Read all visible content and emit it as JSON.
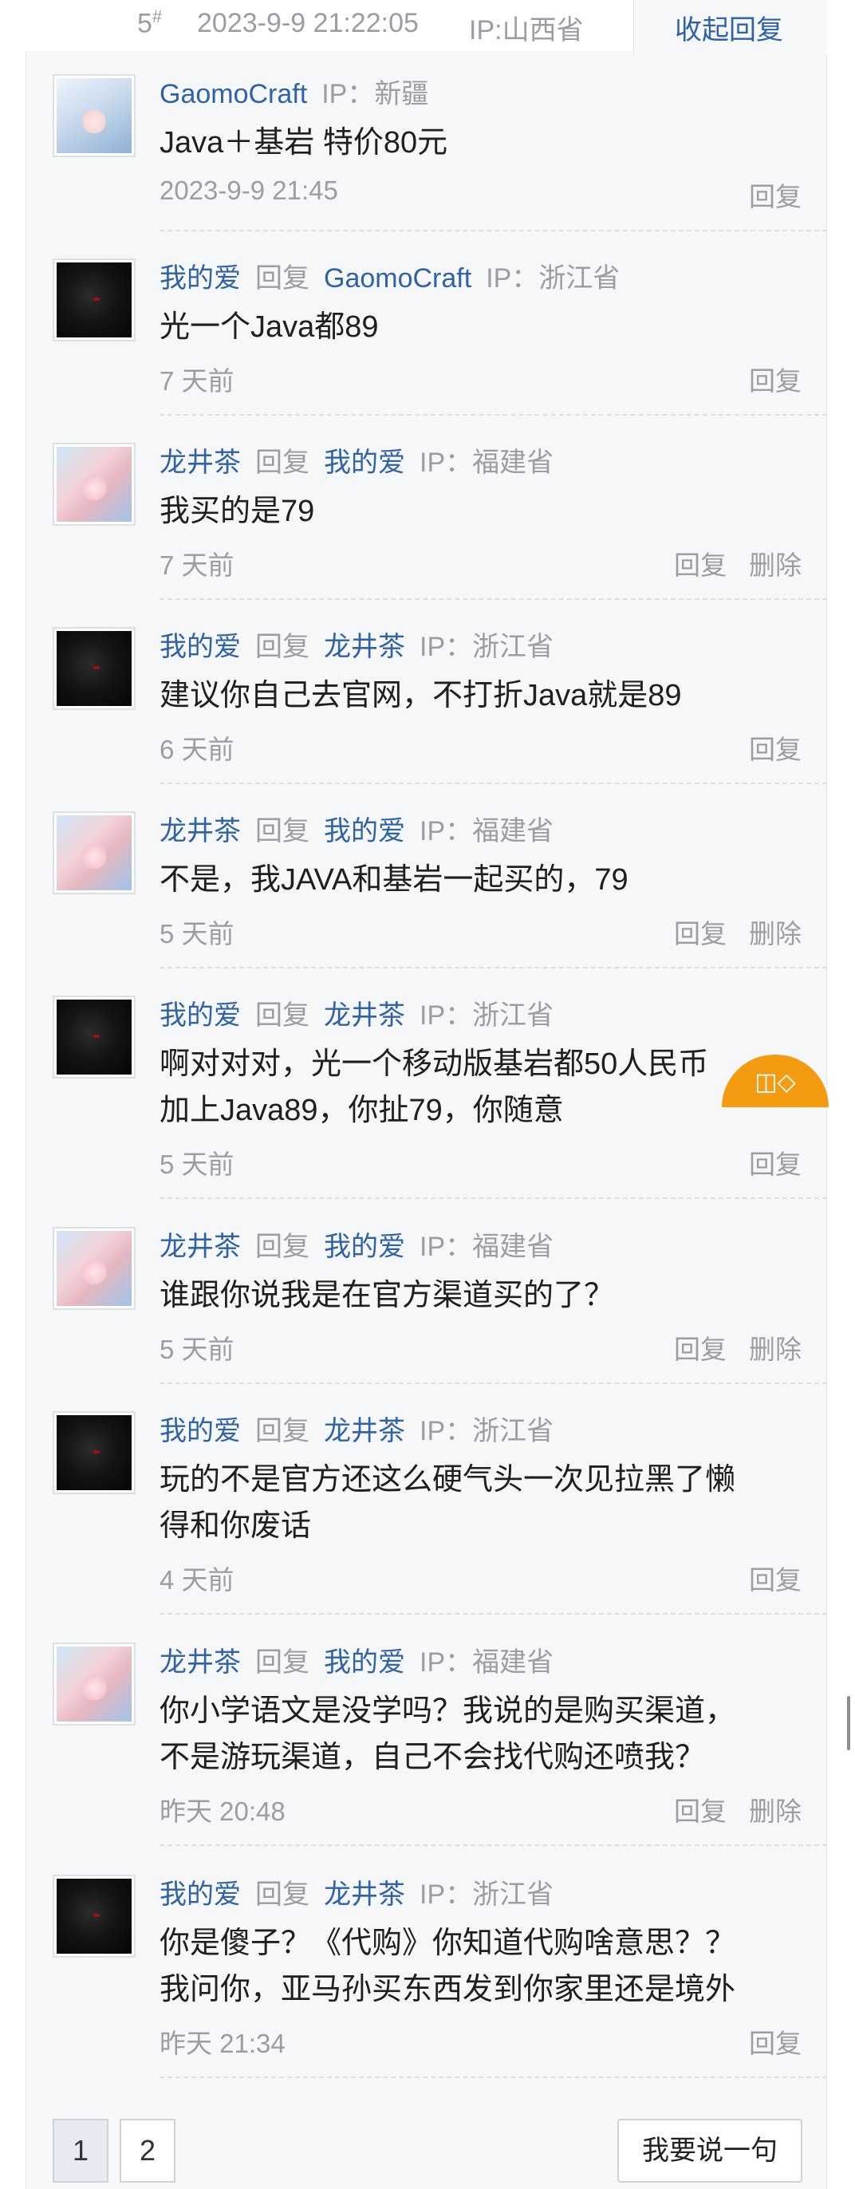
{
  "floor": {
    "number": "5",
    "number_mark": "#",
    "time": "2023-9-9 21:22:05",
    "ip": "IP:山西省",
    "collapse_label": "收起回复"
  },
  "labels": {
    "reply_word": "回复",
    "ip_prefix": "IP：",
    "reply_action": "回复",
    "delete_action": "删除"
  },
  "replies": [
    {
      "avatar": "gao-avatar",
      "user": "GaomoCraft",
      "reply_to": "",
      "ip": "新疆",
      "lines": [
        "Java＋基岩 特价80元"
      ],
      "time": "2023-9-9 21:45",
      "deletable": false
    },
    {
      "avatar": "dark-avatar",
      "user": "我的爱",
      "reply_to": "GaomoCraft",
      "ip": "浙江省",
      "lines": [
        "光一个Java都89"
      ],
      "time": "7 天前",
      "deletable": false
    },
    {
      "avatar": "girl-avatar",
      "user": "龙井茶",
      "reply_to": "我的爱",
      "ip": "福建省",
      "lines": [
        "我买的是79"
      ],
      "time": "7 天前",
      "deletable": true
    },
    {
      "avatar": "dark-avatar",
      "user": "我的爱",
      "reply_to": "龙井茶",
      "ip": "浙江省",
      "lines": [
        "建议你自己去官网，不打折Java就是89"
      ],
      "time": "6 天前",
      "deletable": false
    },
    {
      "avatar": "girl-avatar",
      "user": "龙井茶",
      "reply_to": "我的爱",
      "ip": "福建省",
      "lines": [
        "不是，我JAVA和基岩一起买的，79"
      ],
      "time": "5 天前",
      "deletable": true
    },
    {
      "avatar": "dark-avatar",
      "user": "我的爱",
      "reply_to": "龙井茶",
      "ip": "浙江省",
      "lines": [
        "啊对对对，光一个移动版基岩都50人民币",
        "加上Java89，你扯79，你随意"
      ],
      "time": "5 天前",
      "deletable": false
    },
    {
      "avatar": "girl-avatar",
      "user": "龙井茶",
      "reply_to": "我的爱",
      "ip": "福建省",
      "lines": [
        "谁跟你说我是在官方渠道买的了？"
      ],
      "time": "5 天前",
      "deletable": true
    },
    {
      "avatar": "dark-avatar",
      "user": "我的爱",
      "reply_to": "龙井茶",
      "ip": "浙江省",
      "lines": [
        "玩的不是官方还这么硬气头一次见拉黑了懒",
        "得和你废话"
      ],
      "time": "4 天前",
      "deletable": false
    },
    {
      "avatar": "girl-avatar",
      "user": "龙井茶",
      "reply_to": "我的爱",
      "ip": "福建省",
      "lines": [
        "你小学语文是没学吗？我说的是购买渠道，",
        "不是游玩渠道，自己不会找代购还喷我？"
      ],
      "time": "昨天 20:48",
      "deletable": true
    },
    {
      "avatar": "dark-avatar",
      "user": "我的爱",
      "reply_to": "龙井茶",
      "ip": "浙江省",
      "lines": [
        "你是傻子？《代购》你知道代购啥意思？？",
        "我问你，亚马孙买东西发到你家里还是境外"
      ],
      "time": "昨天 21:34",
      "deletable": false
    }
  ],
  "fab": {
    "icon": "share-icon",
    "label": "◫◇"
  },
  "pager": {
    "pages": [
      "1",
      "2"
    ],
    "active": "1",
    "say_label": "我要说一句"
  },
  "colors": {
    "link": "#2f62a8",
    "muted": "#9a9da3",
    "fab": "#f39c12",
    "panel_bg": "#f6f7f9"
  }
}
